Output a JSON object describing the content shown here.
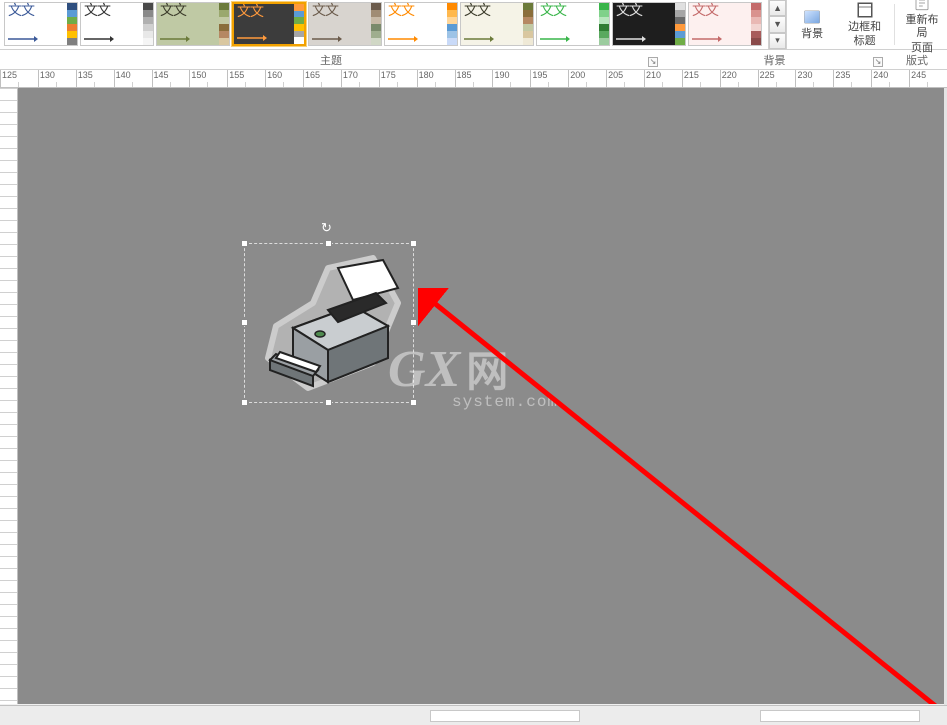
{
  "ribbon": {
    "themes": [
      {
        "bg": "#ffffff",
        "fg": "#3b5998",
        "arrow": "#3b5998",
        "swatches": [
          "#2f4f7f",
          "#5b9bd5",
          "#70ad47",
          "#ed7d31",
          "#ffc000",
          "#7f7f7f"
        ]
      },
      {
        "bg": "#ffffff",
        "fg": "#333333",
        "arrow": "#333333",
        "swatches": [
          "#4a4a4a",
          "#8a8a8a",
          "#b0b0b0",
          "#d0d0d0",
          "#e8e8e8",
          "#f5f5f5"
        ]
      },
      {
        "bg": "#bfc9a4",
        "fg": "#3b3b2a",
        "arrow": "#6b7a3a",
        "swatches": [
          "#6b7a3a",
          "#9aa86e",
          "#c2c9a4",
          "#8a6d3b",
          "#b58863",
          "#d9c7a0"
        ]
      },
      {
        "bg": "#3c3c3c",
        "fg": "#ff9a3c",
        "arrow": "#ff9a3c",
        "swatches": [
          "#ff9a3c",
          "#5b9bd5",
          "#70ad47",
          "#ffc000",
          "#a6a6a6",
          "#ffffff"
        ]
      },
      {
        "bg": "#d8d4cf",
        "fg": "#6b5b4b",
        "arrow": "#6b5b4b",
        "swatches": [
          "#6b5b4b",
          "#a08c74",
          "#c7b9a6",
          "#7a8a6b",
          "#9fae8e",
          "#d0d7c5"
        ]
      },
      {
        "bg": "#ffffff",
        "fg": "#ff8a00",
        "arrow": "#ff8a00",
        "swatches": [
          "#ff8a00",
          "#ffb84d",
          "#ffd699",
          "#5b9bd5",
          "#9dc3e6",
          "#c9daf8"
        ]
      },
      {
        "bg": "#f5f3e7",
        "fg": "#3b3b2a",
        "arrow": "#6b7a3a",
        "swatches": [
          "#6b7a3a",
          "#8a6d3b",
          "#b58863",
          "#c2c9a4",
          "#d9c7a0",
          "#efe9d6"
        ]
      },
      {
        "bg": "#ffffff",
        "fg": "#39b54a",
        "arrow": "#39b54a",
        "swatches": [
          "#39b54a",
          "#7fd18a",
          "#b7e6bd",
          "#2e7d32",
          "#5aa95f",
          "#9ccc9f"
        ]
      },
      {
        "bg": "#1e1e1e",
        "fg": "#e0e0e0",
        "arrow": "#e0e0e0",
        "swatches": [
          "#e0e0e0",
          "#a6a6a6",
          "#6b6b6b",
          "#ff9a3c",
          "#5b9bd5",
          "#70ad47"
        ]
      },
      {
        "bg": "#fdf0ef",
        "fg": "#c46a6a",
        "arrow": "#c46a6a",
        "swatches": [
          "#c46a6a",
          "#d9928e",
          "#e9b8b4",
          "#f2d4d1",
          "#a85b5b",
          "#8a4a4a"
        ]
      }
    ],
    "aa": "文文",
    "background_label": "背景",
    "border_title_label": "边框和标题",
    "relayout_label_line1": "重新布局",
    "relayout_label_line2": "页面",
    "group_theme": "主题",
    "group_background": "背景",
    "group_format": "版式"
  },
  "ruler": {
    "start": 125,
    "end": 245,
    "step": 5
  },
  "watermark": {
    "logo_left": "G",
    "logo_right": "X",
    "logo_cn": "网",
    "sub": "system.com"
  },
  "shape": {
    "name": "printer-clipart"
  }
}
